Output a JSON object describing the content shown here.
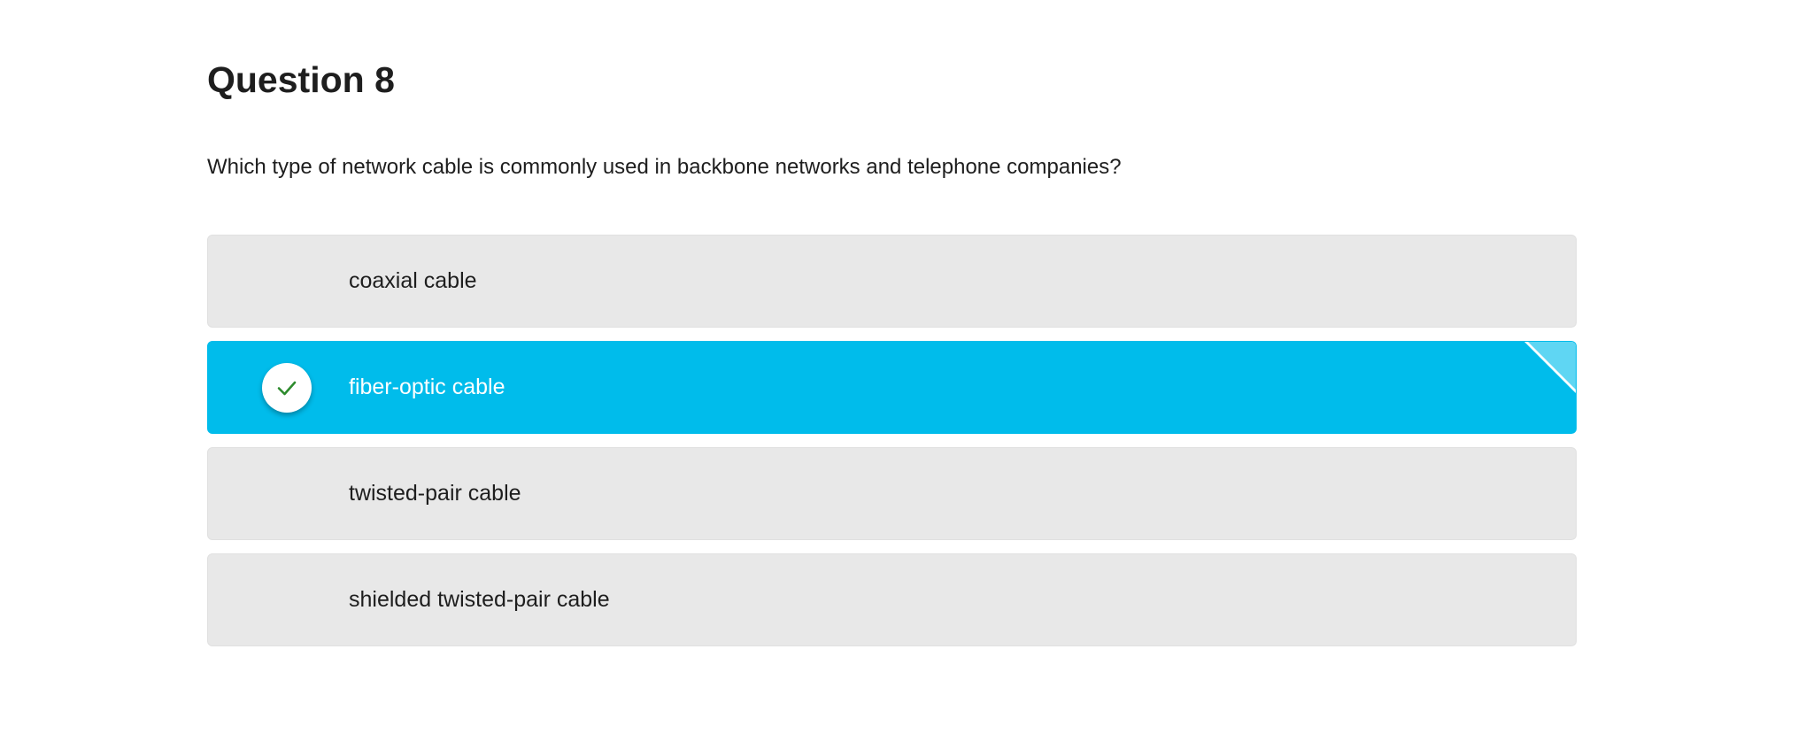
{
  "question": {
    "title": "Question 8",
    "text": "Which type of network cable is commonly used in backbone networks and telephone companies?"
  },
  "options": [
    {
      "label": "coaxial cable",
      "selected": false
    },
    {
      "label": "fiber-optic cable",
      "selected": true,
      "icon": "checkmark-icon"
    },
    {
      "label": "twisted-pair cable",
      "selected": false
    },
    {
      "label": "shielded twisted-pair cable",
      "selected": false
    }
  ],
  "colors": {
    "selected_background": "#00bceb",
    "option_background": "#e8e8e8",
    "checkmark": "#2e8b2e",
    "text": "#1e1e1e"
  }
}
